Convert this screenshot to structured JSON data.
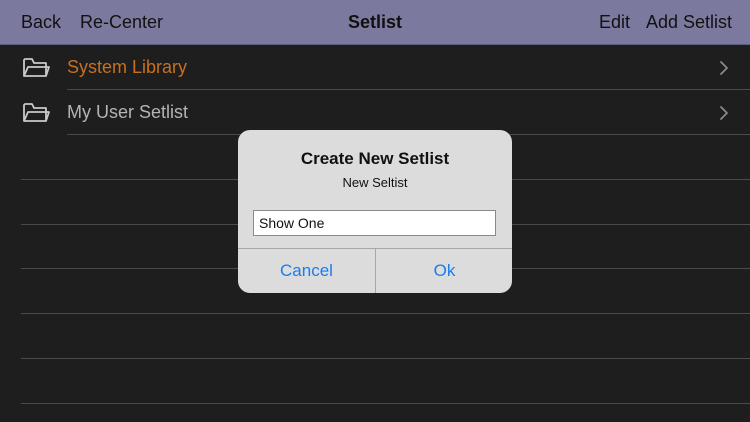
{
  "navbar": {
    "back_label": "Back",
    "recenter_label": "Re-Center",
    "title": "Setlist",
    "edit_label": "Edit",
    "add_label": "Add Setlist",
    "background_color": "#7b7a9e"
  },
  "list": {
    "items": [
      {
        "label": "System Library",
        "icon": "folder-icon",
        "color": "#c8701e"
      },
      {
        "label": "My User Setlist",
        "icon": "folder-icon",
        "color": "#b4b4b4"
      }
    ]
  },
  "dialog": {
    "title": "Create New Setlist",
    "message": "New Seltist",
    "input_value": "Show One",
    "cancel_label": "Cancel",
    "ok_label": "Ok",
    "button_color": "#1a7cf0"
  }
}
